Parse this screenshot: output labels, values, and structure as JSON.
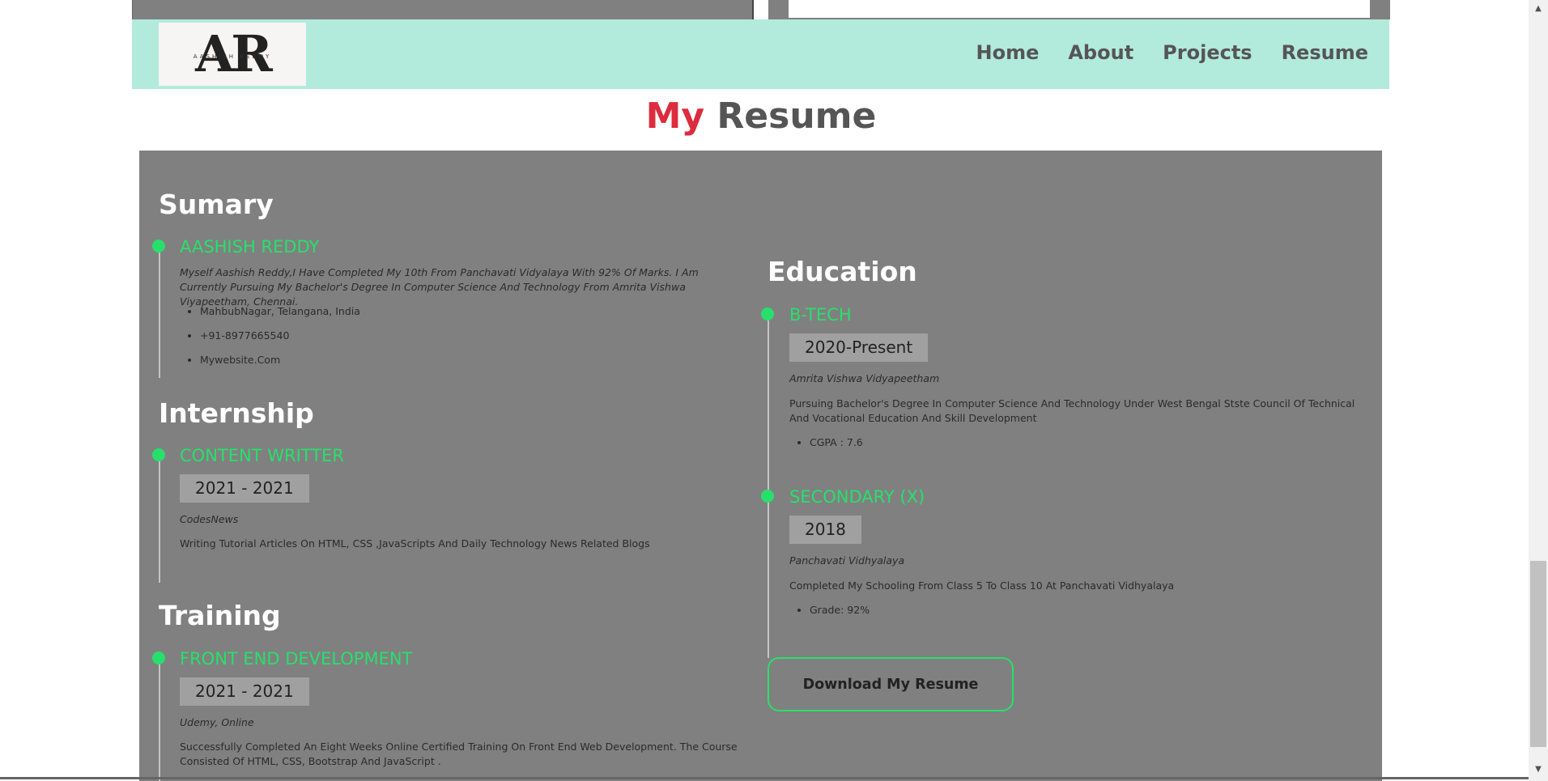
{
  "nav": {
    "logo_letters": "AR",
    "logo_sub": "AASHISH REDDY",
    "links": [
      "Home",
      "About",
      "Projects",
      "Resume"
    ]
  },
  "page": {
    "title_accent": "My",
    "title_rest": "Resume"
  },
  "summary": {
    "heading": "Sumary",
    "name": "AASHISH REDDY",
    "description": "Myself Aashish Reddy,I Have Completed My 10th From Panchavati Vidyalaya With 92% Of Marks. I Am Currently Pursuing My Bachelor's Degree In Computer Science And Technology From Amrita Vishwa Viyapeetham, Chennai.",
    "details": [
      "MahbubNagar, Telangana, India",
      "+91-8977665540",
      "Mywebsite.Com"
    ]
  },
  "internship": {
    "heading": "Internship",
    "title": "CONTENT WRITTER",
    "dates": "2021 - 2021",
    "org": "CodesNews",
    "description": "Writing Tutorial Articles On HTML, CSS ,JavaScripts And Daily Technology News Related Blogs"
  },
  "training": {
    "heading": "Training",
    "title": "FRONT END DEVELOPMENT",
    "dates": "2021 - 2021",
    "org": "Udemy, Online",
    "description": "Successfully Completed An Eight Weeks Online Certified Training On Front End Web Development. The Course Consisted Of HTML, CSS, Bootstrap And JavaScript ."
  },
  "education": {
    "heading": "Education",
    "items": [
      {
        "title": "B-TECH",
        "dates": "2020-Present",
        "org": "Amrita Vishwa Vidyapeetham",
        "description": "Pursuing Bachelor's Degree In Computer Science And Technology Under West Bengal Stste Council Of Technical And Vocational Education And Skill Development",
        "bullet": "CGPA : 7.6"
      },
      {
        "title": "SECONDARY (X)",
        "dates": "2018",
        "org": "Panchavati Vidhyalaya",
        "description": "Completed My Schooling From Class 5 To Class 10 At Panchavati Vidhyalaya",
        "bullet": "Grade: 92%"
      }
    ]
  },
  "download_button": "Download My Resume",
  "colors": {
    "accent_green": "#27e06b",
    "accent_red": "#dc2c3d",
    "nav_bg": "#b2eadb",
    "panel_bg": "#808080"
  },
  "icons": {
    "scroll_up": "scroll-up-arrow-icon",
    "scroll_down": "scroll-down-arrow-icon"
  }
}
